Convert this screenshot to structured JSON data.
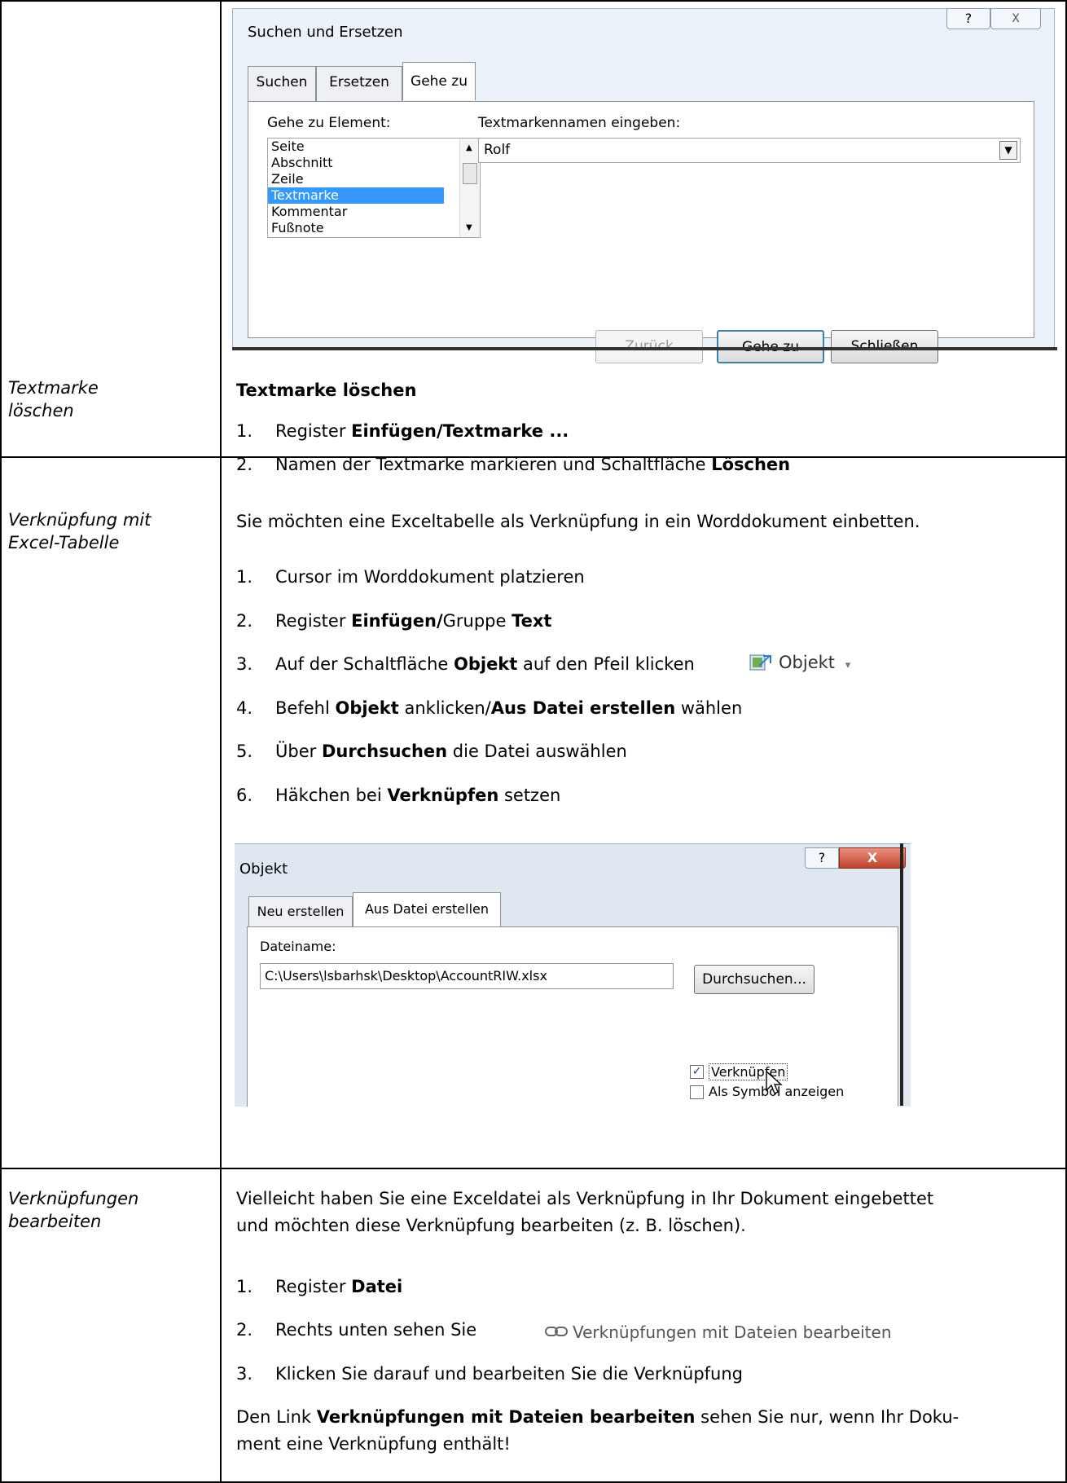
{
  "dialog1": {
    "title": "Suchen und Ersetzen",
    "help_symbol": "?",
    "close_symbol": "X",
    "tabs": [
      "Suchen",
      "Ersetzen",
      "Gehe zu"
    ],
    "active_tab": "Gehe zu",
    "goto_label": "Gehe zu Element:",
    "goto_items": [
      "Seite",
      "Abschnitt",
      "Zeile",
      "Textmarke",
      "Kommentar",
      "Fußnote"
    ],
    "goto_selected": "Textmarke",
    "bookmark_label": "Textmarkennamen eingeben:",
    "bookmark_value": "Rolf",
    "buttons": {
      "back": "Zurück",
      "goto": "Gehe zu",
      "close": "Schließen"
    }
  },
  "row_delete": {
    "left_label_line1": "Textmarke",
    "left_label_line2": "löschen",
    "heading": "Textmarke löschen",
    "step1_num": "1.",
    "step1_pre": "Register ",
    "step1_bold": "Einfügen/Textmarke ...",
    "step2_num": "2.",
    "step2_pre": "Namen der Textmarke markieren und Schaltfläche ",
    "step2_bold": "Löschen"
  },
  "row_link": {
    "left_label_line1": "Verknüpfung mit",
    "left_label_line2": "Excel-Tabelle",
    "intro": "Sie möchten eine Exceltabelle als Verknüpfung in ein Worddokument einbetten.",
    "s1_num": "1.",
    "s1": "Cursor im Worddokument platzieren",
    "s2_num": "2.",
    "s2_pre": "Register ",
    "s2_b1": "Einfügen/",
    "s2_mid": "Gruppe ",
    "s2_b2": "Text",
    "s3_num": "3.",
    "s3_pre": "Auf der Schaltfläche ",
    "s3_b": "Objekt",
    "s3_post": " auf den Pfeil klicken",
    "s4_num": "4.",
    "s4_pre": "Befehl ",
    "s4_b1": "Objekt",
    "s4_mid": " anklicken/",
    "s4_b2": "Aus Datei erstellen",
    "s4_post": " wählen",
    "s5_num": "5.",
    "s5_pre": "Über ",
    "s5_b": "Durchsuchen",
    "s5_post": " die Datei auswählen",
    "s6_num": "6.",
    "s6_pre": "Häkchen bei ",
    "s6_b": "Verknüpfen",
    "s6_post": " setzen",
    "object_button_label": "Objekt",
    "object_button_arrow": "▾"
  },
  "dialog2": {
    "title": "Objekt",
    "help_symbol": "?",
    "close_symbol": "X",
    "tabs": [
      "Neu erstellen",
      "Aus Datei erstellen"
    ],
    "active_tab": "Aus Datei erstellen",
    "filename_label": "Dateiname:",
    "filename_value": "C:\\Users\\lsbarhsk\\Desktop\\AccountRIW.xlsx",
    "browse": "Durchsuchen...",
    "link_checkbox": "Verknüpfen",
    "link_checked": true,
    "icon_checkbox": "Als Symbol anzeigen",
    "icon_checked": false
  },
  "row_edit": {
    "left_label_line1": "Verknüpfungen",
    "left_label_line2": "bearbeiten",
    "intro1": "Vielleicht haben Sie eine Exceldatei als Verknüpfung in Ihr Dokument eingebettet",
    "intro2": "und möchten diese Verknüpfung bearbeiten (z. B. löschen).",
    "e1_num": "1.",
    "e1_pre": "Register ",
    "e1_b": "Datei",
    "e2_num": "2.",
    "e2": "Rechts unten sehen Sie",
    "e3_num": "3.",
    "e3": "Klicken Sie darauf und bearbeiten Sie die Verknüpfung",
    "note_pre": "Den Link ",
    "note_b": "Verknüpfungen mit Dateien bearbeiten",
    "note_post": " sehen Sie nur, wenn Ihr Doku-",
    "note2": "ment eine Verknüpfung enthält!",
    "link_button_label": "Verknüpfungen mit Dateien bearbeiten"
  },
  "colors": {
    "selection": "#3399ff",
    "dialog_bg": "#ecf2f9",
    "close_red": "#c0432c"
  }
}
